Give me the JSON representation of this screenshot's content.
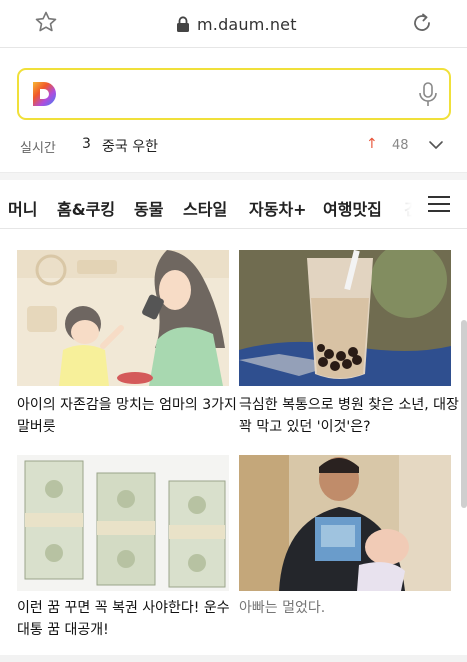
{
  "browser": {
    "url": "m.daum.net"
  },
  "search": {
    "value": "",
    "placeholder": ""
  },
  "realtime": {
    "label": "실시간",
    "rank": "3",
    "keyword": "중국 우한",
    "trend_symbol": "↑",
    "count": "48"
  },
  "tabs": [
    "머니",
    "홈&쿠킹",
    "동물",
    "스타일",
    "자동차+",
    "여행맛집",
    "건"
  ],
  "active_tab": "홈&쿠킹",
  "cards": [
    {
      "title": "아이의 자존감을 망치는 엄마의 3가지 말버릇"
    },
    {
      "title": "극심한 복통으로 병원 찾은 소년, 대장 꽉 막고 있던 '이것'은?"
    },
    {
      "title": "이런 꿈 꾸면 꼭 복권 사야한다! 운수 대통 꿈 대공개!"
    },
    {
      "title": "아빠는 멀었다."
    }
  ],
  "colors": {
    "search_border": "#f0e03a",
    "trend_up": "#e8553a"
  }
}
